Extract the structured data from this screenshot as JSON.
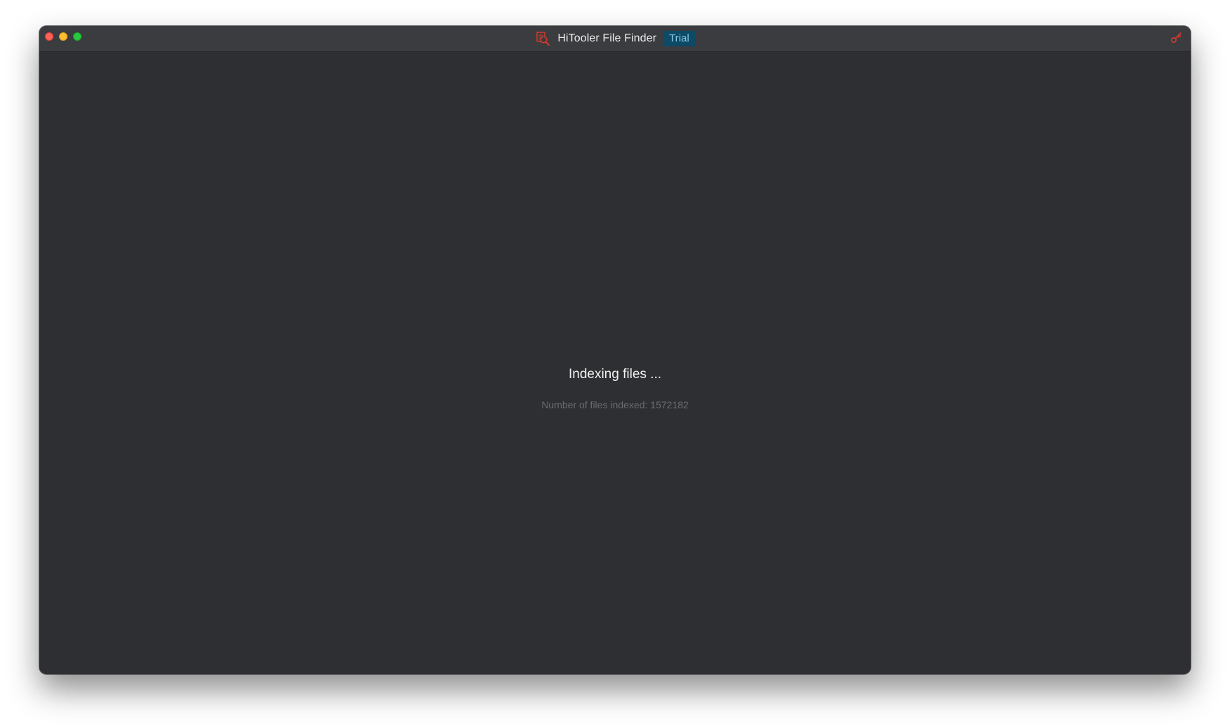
{
  "window": {
    "title": "HiTooler File Finder",
    "badge": "Trial"
  },
  "icons": {
    "app": "file-search-icon",
    "license": "key-icon"
  },
  "colors": {
    "background": "#2e2f32",
    "titlebar": "#3b3c3f",
    "badge_bg": "#0c4a66",
    "badge_text": "#8ac6e3",
    "icon_accent": "#d83a2e"
  },
  "status": {
    "title": "Indexing files ...",
    "detail_label": "Number of files indexed: ",
    "files_indexed": "1572182"
  }
}
